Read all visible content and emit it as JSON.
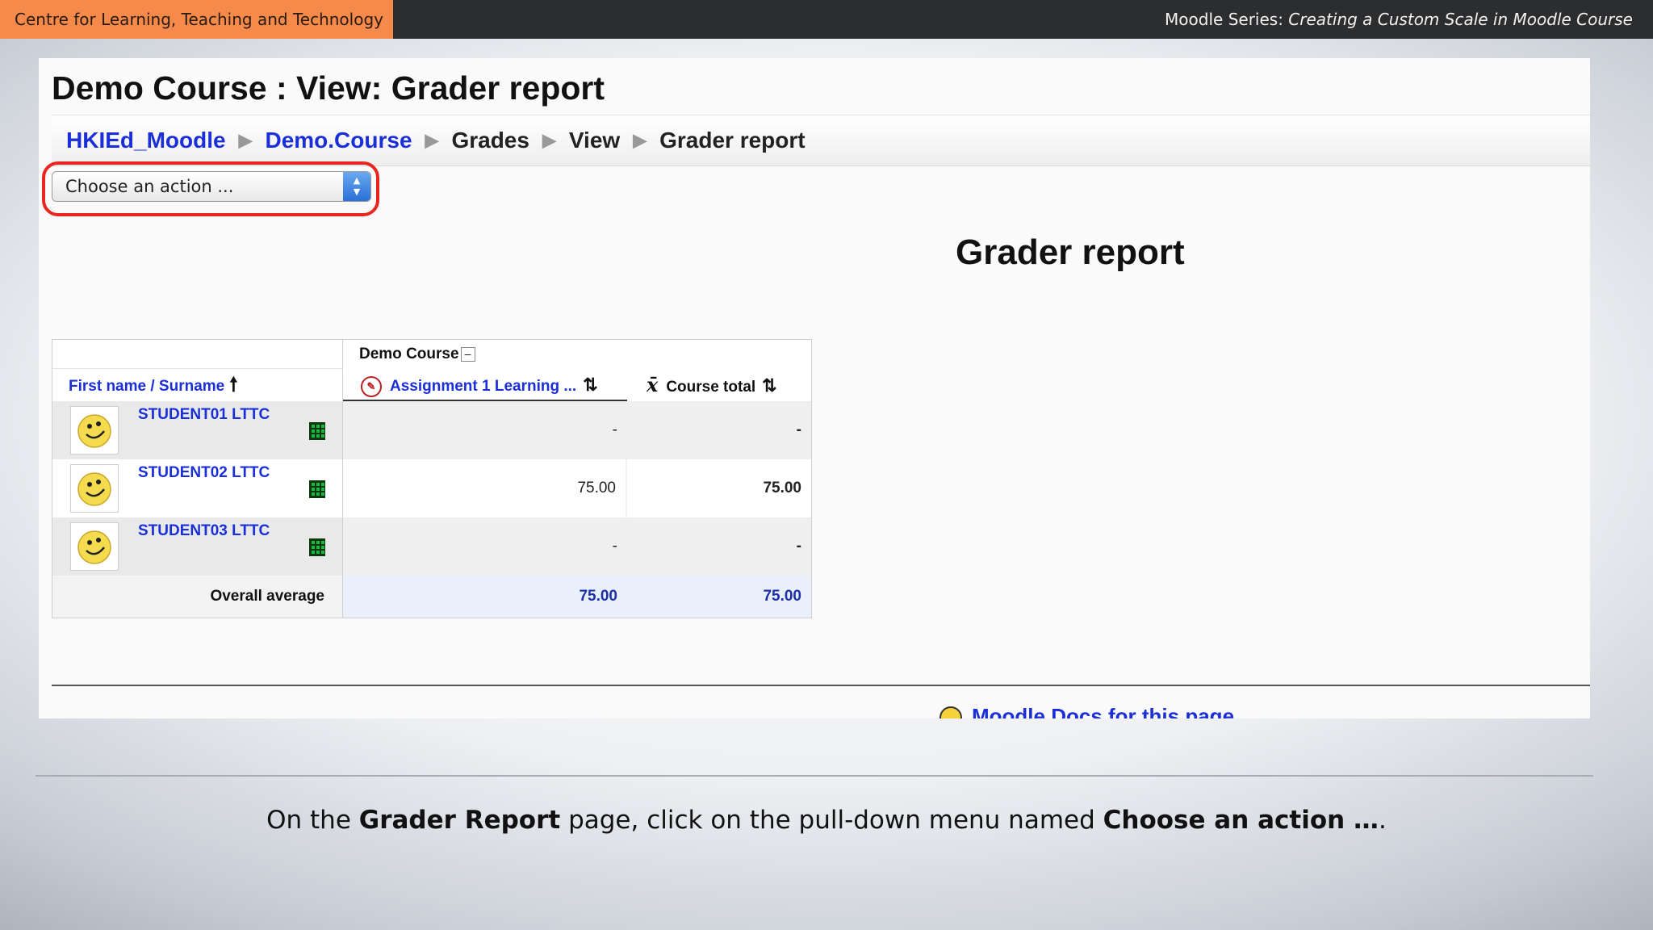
{
  "banner": {
    "org": "Centre for Learning, Teaching and Technology",
    "series_prefix": "Moodle Series: ",
    "series_title": "Creating a Custom Scale in Moodle Course"
  },
  "page": {
    "course_title": "Demo Course : View: Grader report",
    "breadcrumb": [
      {
        "label": "HKIEd_Moodle",
        "link": true
      },
      {
        "label": "Demo.Course",
        "link": true
      },
      {
        "label": "Grades",
        "link": false
      },
      {
        "label": "View",
        "link": false
      },
      {
        "label": "Grader report",
        "link": false
      }
    ],
    "action_select": {
      "selected": "Choose an action ..."
    },
    "report_heading": "Grader report"
  },
  "grader_table": {
    "category": "Demo Course",
    "columns": {
      "name": "First name / Surname",
      "assignment": "Assignment 1 Learning ...",
      "total": "Course total"
    },
    "rows": [
      {
        "student": "STUDENT01 LTTC",
        "assignment": "-",
        "total": "-"
      },
      {
        "student": "STUDENT02 LTTC",
        "assignment": "75.00",
        "total": "75.00"
      },
      {
        "student": "STUDENT03 LTTC",
        "assignment": "-",
        "total": "-"
      }
    ],
    "average": {
      "label": "Overall average",
      "assignment": "75.00",
      "total": "75.00"
    }
  },
  "footer": {
    "docs_link": "Moodle Docs for this page"
  },
  "caption": {
    "p1": "On the ",
    "b1": "Grader Report",
    "p2": " page, click on the pull-down menu named ",
    "b2": "Choose an action …",
    "p3": "."
  },
  "colors": {
    "banner_accent": "#f58a4b",
    "banner_dark": "#2c2d2f",
    "link_blue": "#1a2fd8",
    "highlight_red": "#e8261f"
  }
}
